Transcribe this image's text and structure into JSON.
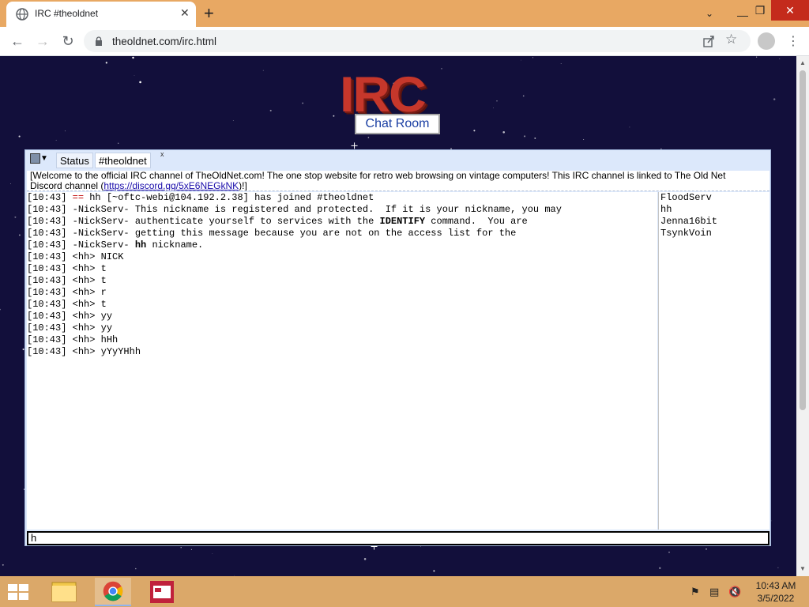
{
  "browser": {
    "tab_title": "IRC #theoldnet",
    "tab_close_label": "✕",
    "new_tab_label": "+",
    "url": "theoldnet.com/irc.html",
    "window_controls": {
      "minimize": "—",
      "maximize": "❐",
      "close": "✕",
      "tab_search": "⌄"
    }
  },
  "page": {
    "logo_text": "IRC",
    "chat_room_label": "Chat Room"
  },
  "irc": {
    "tabs": {
      "status": "Status",
      "channel": "#theoldnet",
      "channel_close": "x"
    },
    "topic_main": "[Welcome to the official IRC channel of TheOldNet.com! The one stop website for retro web browsing on vintage computers! This IRC channel is linked to The Old Net",
    "topic_prefix": "Discord channel (",
    "topic_link": "https://discord.gg/5xE6NEGkNK",
    "topic_suffix": ")!]",
    "messages": [
      {
        "time": "[10:43]",
        "prefix": "==",
        "text": " hh [~oftc-webi@104.192.2.38] has joined #theoldnet"
      },
      {
        "time": "[10:43]",
        "prefix": "",
        "text": " -NickServ- This nickname is registered and protected.  If it is your nickname, you may"
      },
      {
        "time": "[10:43]",
        "prefix": "",
        "text": " -NickServ- authenticate yourself to services with the ",
        "bold": "IDENTIFY",
        "after": " command.  You are"
      },
      {
        "time": "[10:43]",
        "prefix": "",
        "text": " -NickServ- getting this message because you are not on the access list for the"
      },
      {
        "time": "[10:43]",
        "prefix": "",
        "text": " -NickServ- ",
        "bold": "hh",
        "after": " nickname."
      },
      {
        "time": "[10:43]",
        "prefix": "",
        "text": " <hh> NICK"
      },
      {
        "time": "[10:43]",
        "prefix": "",
        "text": " <hh> t"
      },
      {
        "time": "[10:43]",
        "prefix": "",
        "text": " <hh> t"
      },
      {
        "time": "[10:43]",
        "prefix": "",
        "text": " <hh> r"
      },
      {
        "time": "[10:43]",
        "prefix": "",
        "text": " <hh> t"
      },
      {
        "time": "[10:43]",
        "prefix": "",
        "text": " <hh> yy"
      },
      {
        "time": "[10:43]",
        "prefix": "",
        "text": " <hh> yy"
      },
      {
        "time": "[10:43]",
        "prefix": "",
        "text": " <hh> hHh"
      },
      {
        "time": "[10:43]",
        "prefix": "",
        "text": " <hh> yYyYHhh"
      }
    ],
    "users": [
      "FloodServ",
      "hh",
      "Jenna16bit",
      "TsynkVoin"
    ],
    "input_value": "h"
  },
  "taskbar": {
    "time": "10:43 AM",
    "date": "3/5/2022"
  },
  "colors": {
    "titlebar": "#e8a863",
    "page_bg": "#120f3b",
    "panel_bg": "#dce8fb",
    "logo": "#c6372b",
    "taskbar": "#dba869"
  }
}
